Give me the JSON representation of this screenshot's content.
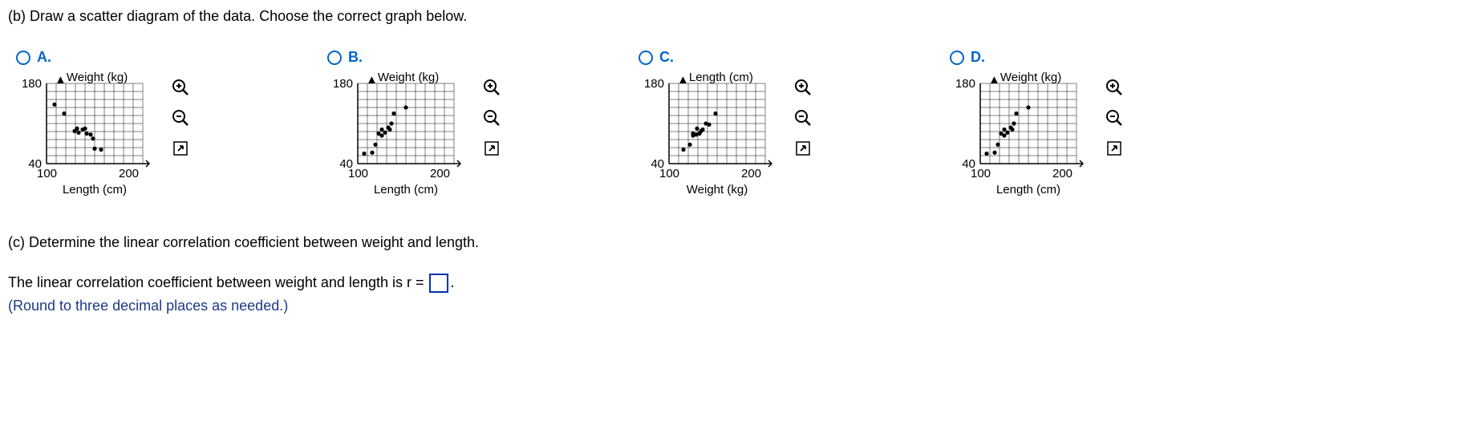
{
  "question_b": "(b) Draw a scatter diagram of the data. Choose the correct graph below.",
  "options": [
    {
      "label": "A.",
      "ylabel": "Weight (kg)",
      "xlabel": "Length (cm)",
      "ytick_top": "180",
      "ytick_bottom": "40",
      "xtick_1": "100",
      "xtick_2": "200"
    },
    {
      "label": "B.",
      "ylabel": "Weight (kg)",
      "xlabel": "Length (cm)",
      "ytick_top": "180",
      "ytick_bottom": "40",
      "xtick_1": "100",
      "xtick_2": "200"
    },
    {
      "label": "C.",
      "ylabel": "Length (cm)",
      "xlabel": "Weight (kg)",
      "ytick_top": "180",
      "ytick_bottom": "40",
      "xtick_1": "100",
      "xtick_2": "200"
    },
    {
      "label": "D.",
      "ylabel": "Weight (kg)",
      "xlabel": "Length (cm)",
      "ytick_top": "180",
      "ytick_bottom": "40",
      "xtick_1": "100",
      "xtick_2": "200"
    }
  ],
  "question_c": "(c) Determine the linear correlation coefficient between weight and length.",
  "answer_prefix": "The linear correlation coefficient between weight and length is r = ",
  "answer_suffix": ".",
  "hint": "(Round to three decimal places as needed.)",
  "chart_data": [
    {
      "type": "scatter",
      "title": "",
      "xlabel": "Length (cm)",
      "ylabel": "Weight (kg)",
      "xlim": [
        100,
        220
      ],
      "ylim": [
        40,
        200
      ],
      "points": [
        [
          110,
          158
        ],
        [
          122,
          140
        ],
        [
          138,
          110
        ],
        [
          135,
          105
        ],
        [
          140,
          102
        ],
        [
          148,
          110
        ],
        [
          145,
          108
        ],
        [
          150,
          100
        ],
        [
          155,
          98
        ],
        [
          158,
          90
        ],
        [
          160,
          70
        ],
        [
          168,
          68
        ]
      ]
    },
    {
      "type": "scatter",
      "title": "",
      "xlabel": "Length (cm)",
      "ylabel": "Weight (kg)",
      "xlim": [
        100,
        220
      ],
      "ylim": [
        40,
        200
      ],
      "points": [
        [
          108,
          60
        ],
        [
          118,
          62
        ],
        [
          122,
          78
        ],
        [
          126,
          100
        ],
        [
          130,
          96
        ],
        [
          130,
          108
        ],
        [
          134,
          102
        ],
        [
          140,
          108
        ],
        [
          138,
          112
        ],
        [
          142,
          120
        ],
        [
          145,
          140
        ],
        [
          160,
          152
        ]
      ]
    },
    {
      "type": "scatter",
      "title": "",
      "xlabel": "Weight (kg)",
      "ylabel": "Length (cm)",
      "xlim": [
        100,
        220
      ],
      "ylim": [
        40,
        200
      ],
      "points": [
        [
          118,
          68
        ],
        [
          126,
          78
        ],
        [
          130,
          96
        ],
        [
          130,
          100
        ],
        [
          134,
          98
        ],
        [
          138,
          100
        ],
        [
          140,
          105
        ],
        [
          142,
          108
        ],
        [
          135,
          110
        ],
        [
          146,
          120
        ],
        [
          150,
          118
        ],
        [
          158,
          140
        ]
      ]
    },
    {
      "type": "scatter",
      "title": "",
      "xlabel": "Length (cm)",
      "ylabel": "Weight (kg)",
      "xlim": [
        100,
        220
      ],
      "ylim": [
        40,
        200
      ],
      "points": [
        [
          108,
          60
        ],
        [
          118,
          62
        ],
        [
          122,
          78
        ],
        [
          126,
          100
        ],
        [
          130,
          96
        ],
        [
          130,
          108
        ],
        [
          134,
          102
        ],
        [
          140,
          108
        ],
        [
          138,
          112
        ],
        [
          142,
          120
        ],
        [
          145,
          140
        ],
        [
          160,
          152
        ]
      ]
    }
  ]
}
